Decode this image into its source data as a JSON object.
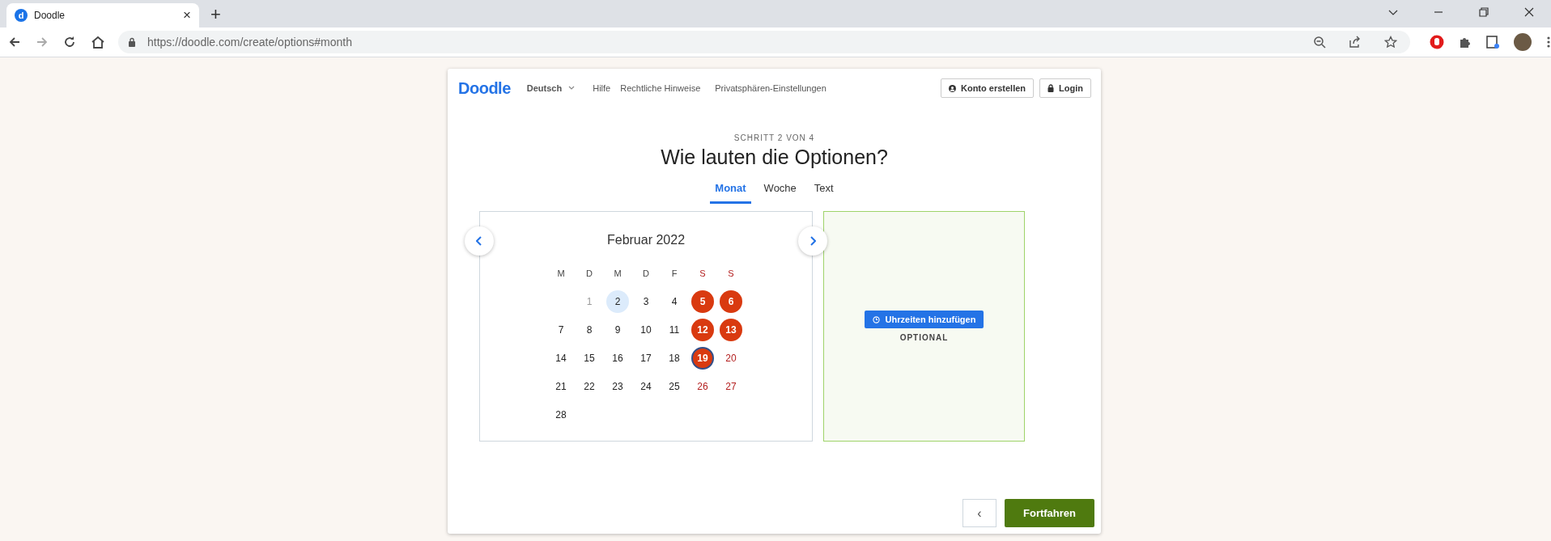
{
  "browser": {
    "tab": {
      "favicon_letter": "d",
      "title": "Doodle",
      "close": "×"
    },
    "new_tab": "+",
    "url": {
      "host": "https://doodle.com",
      "path": "/create/options#month"
    }
  },
  "header": {
    "logo": "Doodle",
    "language": "Deutsch",
    "links": [
      "Hilfe",
      "Rechtliche Hinweise",
      "Privatsphären-Einstellungen"
    ],
    "buttons": [
      {
        "kind": "account",
        "label": "Konto erstellen"
      },
      {
        "kind": "login",
        "label": "Login"
      }
    ]
  },
  "step": "SCHRITT 2 VON 4",
  "heading": "Wie lauten die Optionen?",
  "tabs": [
    {
      "label": "Monat",
      "selected": true
    },
    {
      "label": "Woche",
      "selected": false
    },
    {
      "label": "Text",
      "selected": false
    }
  ],
  "calendar": {
    "month": "Februar 2022",
    "weekdays": [
      "M",
      "D",
      "M",
      "D",
      "F",
      "S",
      "S"
    ],
    "weeks": [
      [
        {
          "label": "1",
          "past": true,
          "today": false,
          "selected": false,
          "focused": false
        },
        {
          "label": "2",
          "past": false,
          "today": true,
          "selected": false,
          "focused": false
        },
        {
          "label": "3",
          "past": false,
          "today": false,
          "selected": false,
          "focused": false
        },
        {
          "label": "4",
          "past": false,
          "today": false,
          "selected": false,
          "focused": false
        },
        {
          "label": "5",
          "past": false,
          "today": false,
          "selected": true,
          "focused": false
        },
        {
          "label": "6",
          "past": false,
          "today": false,
          "selected": true,
          "focused": false
        }
      ],
      [
        {
          "label": "7",
          "past": false,
          "today": false,
          "selected": false,
          "focused": false
        },
        {
          "label": "8",
          "past": false,
          "today": false,
          "selected": false,
          "focused": false
        },
        {
          "label": "9",
          "past": false,
          "today": false,
          "selected": false,
          "focused": false
        },
        {
          "label": "10",
          "past": false,
          "today": false,
          "selected": false,
          "focused": false
        },
        {
          "label": "11",
          "past": false,
          "today": false,
          "selected": false,
          "focused": false
        },
        {
          "label": "12",
          "past": false,
          "today": false,
          "selected": true,
          "focused": false
        },
        {
          "label": "13",
          "past": false,
          "today": false,
          "selected": true,
          "focused": false
        }
      ],
      [
        {
          "label": "14",
          "past": false,
          "today": false,
          "selected": false,
          "focused": false
        },
        {
          "label": "15",
          "past": false,
          "today": false,
          "selected": false,
          "focused": false
        },
        {
          "label": "16",
          "past": false,
          "today": false,
          "selected": false,
          "focused": false
        },
        {
          "label": "17",
          "past": false,
          "today": false,
          "selected": false,
          "focused": false
        },
        {
          "label": "18",
          "past": false,
          "today": false,
          "selected": false,
          "focused": false
        },
        {
          "label": "19",
          "past": false,
          "today": false,
          "selected": true,
          "focused": true
        },
        {
          "label": "20",
          "past": false,
          "today": false,
          "selected": false,
          "focused": false
        }
      ],
      [
        {
          "label": "21",
          "past": false,
          "today": false,
          "selected": false,
          "focused": false
        },
        {
          "label": "22",
          "past": false,
          "today": false,
          "selected": false,
          "focused": false
        },
        {
          "label": "23",
          "past": false,
          "today": false,
          "selected": false,
          "focused": false
        },
        {
          "label": "24",
          "past": false,
          "today": false,
          "selected": false,
          "focused": false
        },
        {
          "label": "25",
          "past": false,
          "today": false,
          "selected": false,
          "focused": false
        },
        {
          "label": "26",
          "past": false,
          "today": false,
          "selected": false,
          "focused": false
        },
        {
          "label": "27",
          "past": false,
          "today": false,
          "selected": false,
          "focused": false
        }
      ],
      [
        {
          "label": "28",
          "past": false,
          "today": false,
          "selected": false,
          "focused": false
        }
      ]
    ]
  },
  "times": {
    "button": "Uhrzeiten hinzufügen",
    "note": "OPTIONAL"
  },
  "footer": {
    "back": "‹",
    "next": "Fortfahren"
  }
}
